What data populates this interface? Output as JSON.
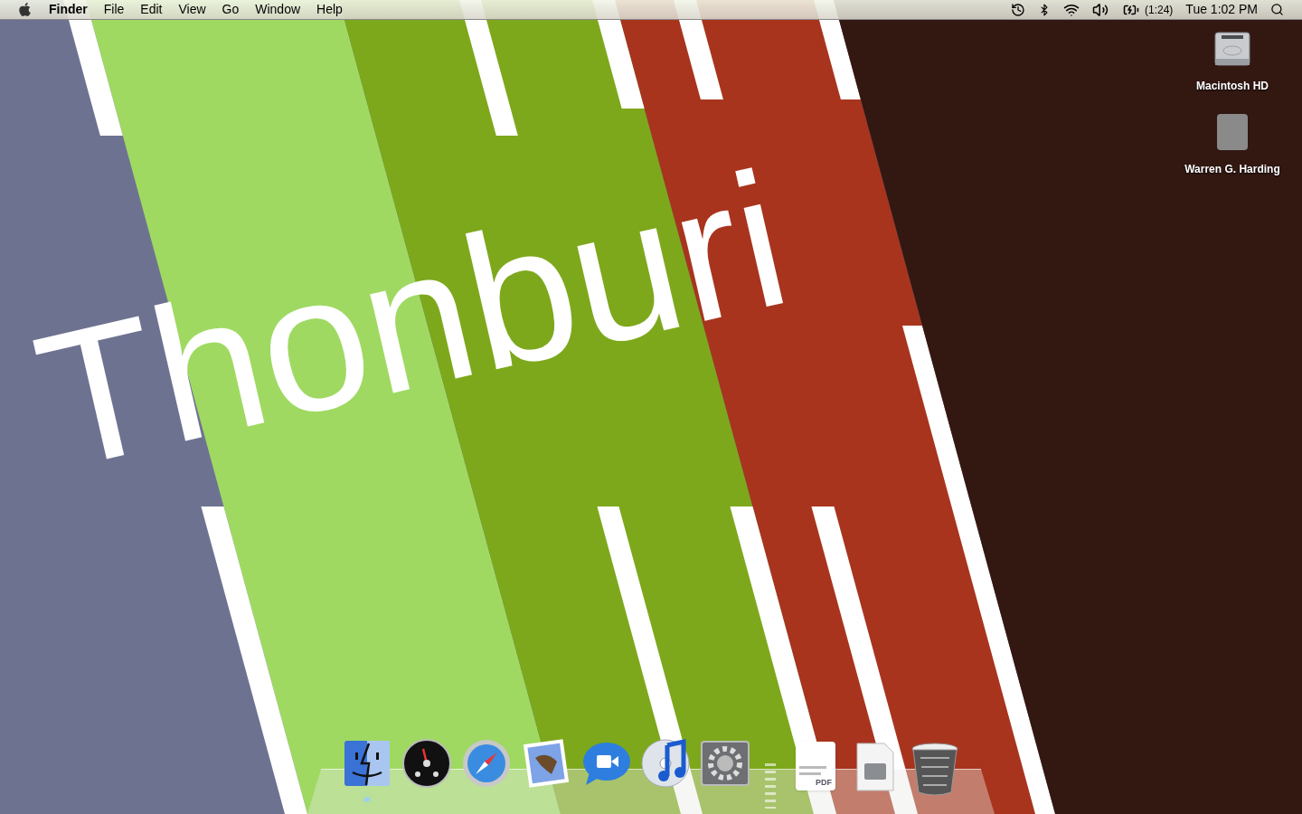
{
  "menu_bar": {
    "app_name": "Finder",
    "menus": [
      "File",
      "Edit",
      "View",
      "Go",
      "Window",
      "Help"
    ],
    "battery_time": "(1:24)",
    "clock": "Tue 1:02 PM"
  },
  "wallpaper": {
    "text": "Thonburi"
  },
  "desktop_icons": [
    {
      "kind": "drive",
      "label": "Macintosh HD"
    },
    {
      "kind": "photo",
      "label": "Warren G. Harding"
    }
  ],
  "dock": {
    "apps": [
      {
        "kind": "finder",
        "running": true
      },
      {
        "kind": "dashboard",
        "running": false
      },
      {
        "kind": "safari",
        "running": false
      },
      {
        "kind": "mail",
        "running": false
      },
      {
        "kind": "ichat",
        "running": false
      },
      {
        "kind": "itunes",
        "running": false
      },
      {
        "kind": "preferences",
        "running": false
      }
    ],
    "others": [
      {
        "kind": "pdf",
        "badge": "PDF"
      },
      {
        "kind": "diskimage"
      },
      {
        "kind": "trash"
      }
    ]
  }
}
